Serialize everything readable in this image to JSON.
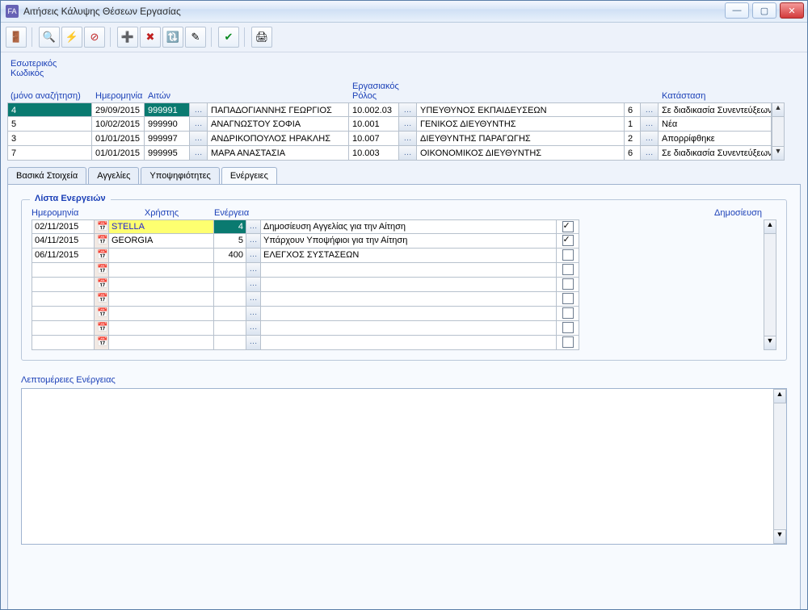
{
  "window": {
    "title": "Αιτήσεις Κάλυψης Θέσεων Εργασίας",
    "app_icon_label": "FA"
  },
  "toolbar": {
    "btn_exit_icon": "exit-door-icon",
    "btn_query_icon": "query-icon",
    "btn_refresh_icon": "refresh-icon",
    "btn_cancel_icon": "cancel-circle-icon",
    "btn_add_icon": "plus-icon",
    "btn_delete_icon": "x-red-icon",
    "btn_sort_icon": "sort-icon",
    "btn_edit_icon": "pencil-icon",
    "btn_ok_icon": "check-green-icon",
    "btn_print_icon": "printer-icon"
  },
  "topgrid": {
    "header_internal_code_1": "Εσωτερικός Κωδικός",
    "header_internal_code_2": "(μόνο αναζήτηση)",
    "header_date": "Ημερομηνία",
    "header_requester": "Αιτών",
    "header_role": "Εργασιακός Ρόλος",
    "header_status": "Κατάσταση",
    "rows": [
      {
        "code": "4",
        "date": "29/09/2015",
        "req_code": "999991",
        "req_name": "ΠΑΠΑΔΟΓΙΑΝΝΗΣ ΓΕΩΡΓΙΟΣ",
        "role_code": "10.002.03",
        "role_name": "ΥΠΕΥΘΥΝΟΣ ΕΚΠΑΙΔΕΥΣΕΩΝ",
        "stat_code": "6",
        "stat_name": "Σε διαδικασία Συνεντεύξεων",
        "sel": true
      },
      {
        "code": "5",
        "date": "10/02/2015",
        "req_code": "999990",
        "req_name": "ΑΝΑΓΝΩΣΤΟΥ ΣΟΦΙΑ",
        "role_code": "10.001",
        "role_name": "ΓΕΝΙΚΟΣ ΔΙΕΥΘΥΝΤΗΣ",
        "stat_code": "1",
        "stat_name": "Νέα"
      },
      {
        "code": "3",
        "date": "01/01/2015",
        "req_code": "999997",
        "req_name": "ΑΝΔΡΙΚΟΠΟΥΛΟΣ ΗΡΑΚΛΗΣ",
        "role_code": "10.007",
        "role_name": "ΔΙΕΥΘΥΝΤΗΣ ΠΑΡΑΓΩΓΗΣ",
        "stat_code": "2",
        "stat_name": "Απορρίφθηκε"
      },
      {
        "code": "7",
        "date": "01/01/2015",
        "req_code": "999995",
        "req_name": "ΜΑΡΑ ΑΝΑΣΤΑΣΙΑ",
        "role_code": "10.003",
        "role_name": "ΟΙΚΟΝΟΜΙΚΟΣ ΔΙΕΥΘΥΝΤΗΣ",
        "stat_code": "6",
        "stat_name": "Σε διαδικασία Συνεντεύξεων"
      }
    ]
  },
  "tabs": {
    "tab1": "Βασικά Στοιχεία",
    "tab2": "Αγγελίες",
    "tab3": "Υποψηφιότητες",
    "tab4": "Ενέργειες"
  },
  "actions": {
    "group_title": "Λίστα Ενεργειών",
    "h_date": "Ημερομηνία",
    "h_user": "Χρήστης",
    "h_action": "Ενέργεια",
    "h_publish": "Δημοσίευση",
    "rows": [
      {
        "date": "02/11/2015",
        "user": "STELLA",
        "act": "4",
        "desc": "Δημοσίευση Αγγελίας για την Αίτηση",
        "pub": true,
        "sel": true
      },
      {
        "date": "04/11/2015",
        "user": "GEORGIA",
        "act": "5",
        "desc": "Υπάρχουν Υποψήφιοι για την Αίτηση",
        "pub": true
      },
      {
        "date": "06/11/2015",
        "user": "",
        "act": "400",
        "desc": "ΕΛΕΓΧΟΣ ΣΥΣΤΑΣΕΩΝ",
        "pub": false
      },
      {
        "date": "",
        "user": "",
        "act": "",
        "desc": "",
        "pub": false
      },
      {
        "date": "",
        "user": "",
        "act": "",
        "desc": "",
        "pub": false
      },
      {
        "date": "",
        "user": "",
        "act": "",
        "desc": "",
        "pub": false
      },
      {
        "date": "",
        "user": "",
        "act": "",
        "desc": "",
        "pub": false
      },
      {
        "date": "",
        "user": "",
        "act": "",
        "desc": "",
        "pub": false
      },
      {
        "date": "",
        "user": "",
        "act": "",
        "desc": "",
        "pub": false
      }
    ],
    "details_label": "Λεπτομέρειες Ενέργειας",
    "details_text": ""
  },
  "glyphs": {
    "ellipsis": "…",
    "calendar": "📅",
    "up": "▲",
    "down": "▼"
  }
}
